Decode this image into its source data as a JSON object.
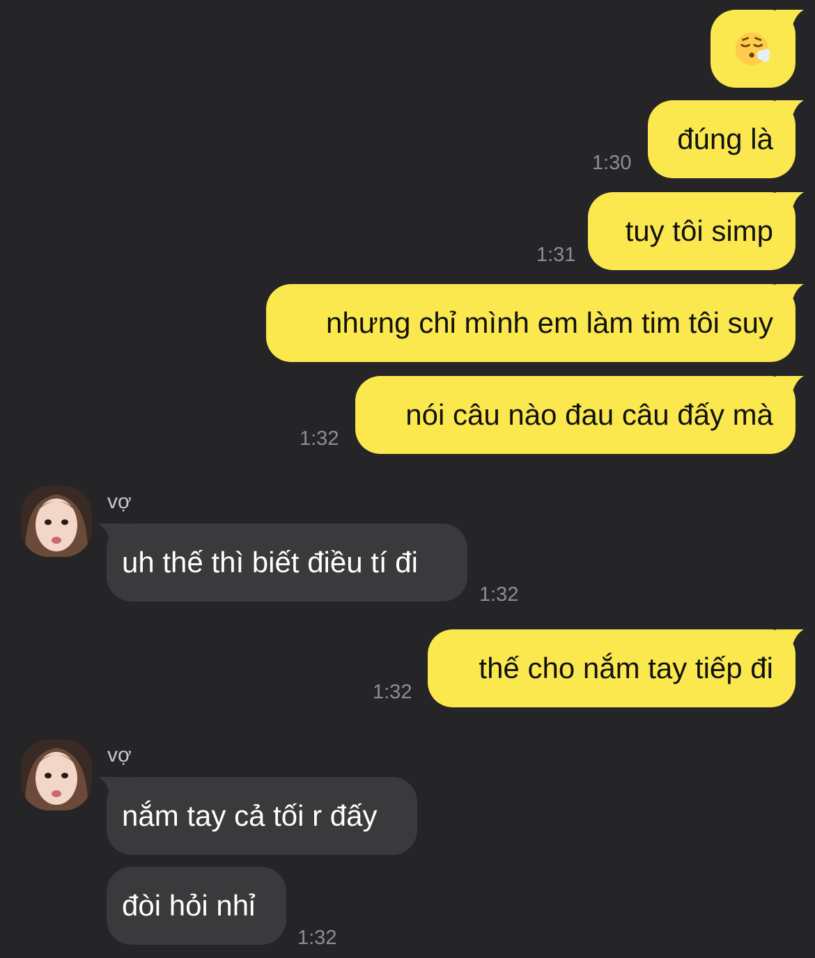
{
  "colors": {
    "background": "#252527",
    "outgoing_bubble": "#FBE74E",
    "incoming_bubble": "#3A3A3C",
    "timestamp": "#8E8E93"
  },
  "messages": {
    "m1": {
      "icon": "sleepy-face-emoji"
    },
    "m2": {
      "text": "đúng là",
      "time": "1:30"
    },
    "m3": {
      "text": "tuy tôi simp",
      "time": "1:31"
    },
    "m4": {
      "text": "nhưng chỉ mình em làm tim tôi suy"
    },
    "m5": {
      "text": "nói câu nào đau câu đấy mà",
      "time": "1:32"
    },
    "m6": {
      "sender": "vợ",
      "text": "uh thế thì biết điều tí đi",
      "time": "1:32"
    },
    "m7": {
      "text": "thế cho nắm tay tiếp đi",
      "time": "1:32"
    },
    "m8": {
      "sender": "vợ",
      "text": "nắm tay cả tối r đấy"
    },
    "m9": {
      "text": "đòi hỏi nhỉ",
      "time": "1:32"
    }
  }
}
